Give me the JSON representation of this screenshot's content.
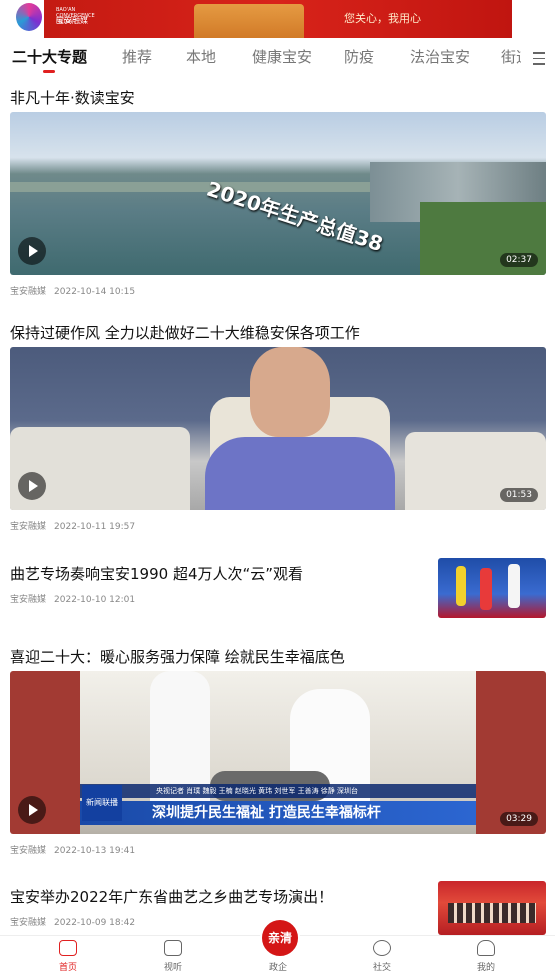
{
  "banner": {
    "logo_text": "宝安融媒",
    "logo_small": "BAO'AN CONVERGENCE MEDIA",
    "slogan": "您关心，我用心"
  },
  "tabs": [
    "二十大专题",
    "推荐",
    "本地",
    "健康宝安",
    "防疫",
    "法治宝安",
    "街道"
  ],
  "articles": [
    {
      "title": "非凡十年·数读宝安",
      "source": "宝安融媒",
      "time": "2022-10-14 10:15",
      "duration": "02:37",
      "overlay": "2020年生产总值38"
    },
    {
      "title": "保持过硬作风 全力以赴做好二十大维稳安保各项工作",
      "source": "宝安融媒",
      "time": "2022-10-11 19:57",
      "duration": "01:53"
    },
    {
      "title": "曲艺专场奏响宝安1990  超4万人次“云”观看",
      "source": "宝安融媒",
      "time": "2022-10-10 12:01"
    },
    {
      "title": "喜迎二十大：暖心服务强力保障 绘就民生幸福底色",
      "source": "宝安融媒",
      "time": "2022-10-13 19:41",
      "duration": "03:29",
      "caption_top": "央视记者 肖璞 魏毅 王楠 赵晓光 黄玮 刘世军 王善涛 徐静 深圳台",
      "caption_main": "深圳提升民生福祉 打造民生幸福标杆",
      "tv_logo": "新闻联播"
    },
    {
      "title": "宝安举办2022年广东省曲艺之乡曲艺专场演出！",
      "source": "宝安融媒",
      "time": "2022-10-09 18:42"
    }
  ],
  "nav": {
    "home": "首页",
    "video": "视听",
    "center_btn": "亲清",
    "center": "政企",
    "social": "社交",
    "mine": "我的"
  }
}
